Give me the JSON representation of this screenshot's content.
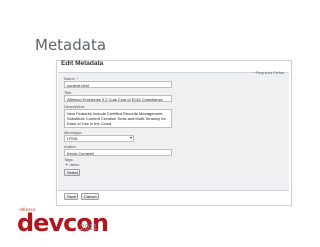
{
  "slide": {
    "title": "Metadata"
  },
  "panel": {
    "header": "Edit Metadata",
    "required_note": "Required Fields"
  },
  "fields": {
    "name": {
      "label": "Name:",
      "value": "content.html"
    },
    "title": {
      "label": "Title:",
      "value": "Alfresco Enterprise 3.2 Cuts Cost of ECM Compliance"
    },
    "description": {
      "label": "Description:",
      "value": "New Features Include Certified Records Management, Substitute Content Creation Tools and Multi-Tenancy for Ease of Use in the Cloud"
    },
    "mimetype": {
      "label": "Mimetype:",
      "value": "HTML"
    },
    "author": {
      "label": "Author:",
      "value": "Kevin Cornwell"
    },
    "tags": {
      "label": "Tags:",
      "items": [
        "demo"
      ],
      "select_label": "Select"
    }
  },
  "actions": {
    "save": "Save",
    "cancel": "Cancel"
  },
  "branding": {
    "company": "Alfresco",
    "event": "devcon",
    "year": "2011"
  },
  "colors": {
    "brand_red": "#b0161d",
    "form_bg": "#eef0f2"
  }
}
